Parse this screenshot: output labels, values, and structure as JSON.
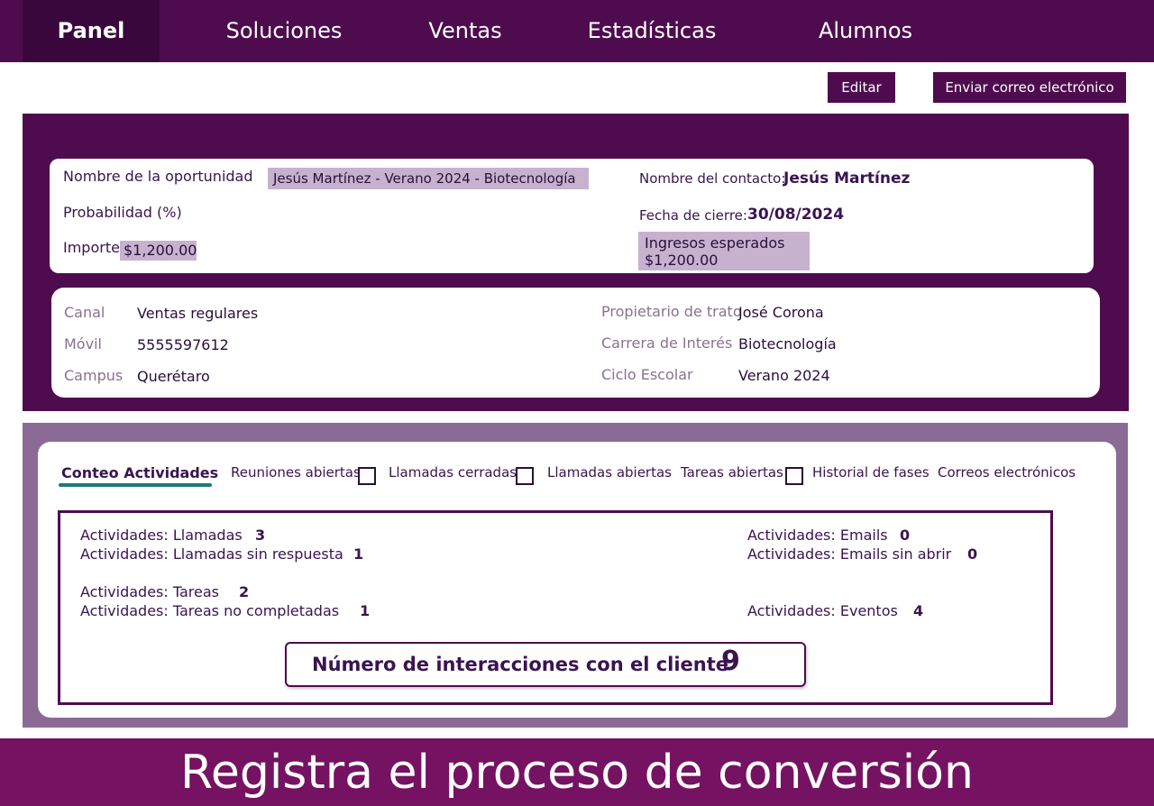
{
  "nav": {
    "items": [
      "Panel",
      "Soluciones",
      "Ventas",
      "Estadísticas",
      "Alumnos"
    ],
    "active": "Panel"
  },
  "toolbar": {
    "edit_label": "Editar",
    "email_label": "Enviar correo electrónico"
  },
  "opportunity": {
    "name_label": "Nombre de la oportunidad",
    "name_value": "Jesús Martínez - Verano 2024 - Biotecnología",
    "probability_label": "Probabilidad (%)",
    "amount_label": "Importe",
    "amount_value": "$1,200.00",
    "contact_label": "Nombre del contacto:",
    "contact_value": "Jesús Martínez",
    "close_date_label": "Fecha de cierre:",
    "close_date_value": "30/08/2024",
    "expected_label": "Ingresos esperados",
    "expected_value": "$1,200.00"
  },
  "details": {
    "channel_label": "Canal",
    "channel_value": "Ventas regulares",
    "mobile_label": "Móvil",
    "mobile_value": "5555597612",
    "campus_label": "Campus",
    "campus_value": "Querétaro",
    "owner_label": "Propietario de trato",
    "owner_value": "José Corona",
    "career_label": "Carrera de Interés",
    "career_value": "Biotecnología",
    "cycle_label": "Ciclo Escolar",
    "cycle_value": "Verano 2024"
  },
  "tabs": {
    "activity_count": "Conteo Actividades",
    "open_meetings": "Reuniones abiertas",
    "closed_calls": "Llamadas cerradas",
    "open_calls": "Llamadas abiertas",
    "open_tasks": "Tareas abiertas",
    "stage_history": "Historial de fases",
    "emails": "Correos electrónicos"
  },
  "stats": {
    "calls_label": "Actividades: Llamadas",
    "calls_value": "3",
    "unanswered_label": "Actividades: Llamadas sin respuesta",
    "unanswered_value": "1",
    "tasks_label": "Actividades:  Tareas",
    "tasks_value": "2",
    "incomplete_label": "Actividades:  Tareas no completadas",
    "incomplete_value": "1",
    "emails_label": "Actividades: Emails",
    "emails_value": "0",
    "unopened_label": "Actividades: Emails sin abrir",
    "unopened_value": "0",
    "events_label": "Actividades:  Eventos",
    "events_value": "4",
    "interactions_label": "Número de interacciones con el cliente",
    "interactions_value": "9"
  },
  "banner": {
    "text": "Registra el proceso de conversión"
  },
  "colors": {
    "brand_purple": "#4e0c4f",
    "banner": "#751262",
    "highlight": "#c6b2cf",
    "tab_underline": "#1e7a78"
  }
}
